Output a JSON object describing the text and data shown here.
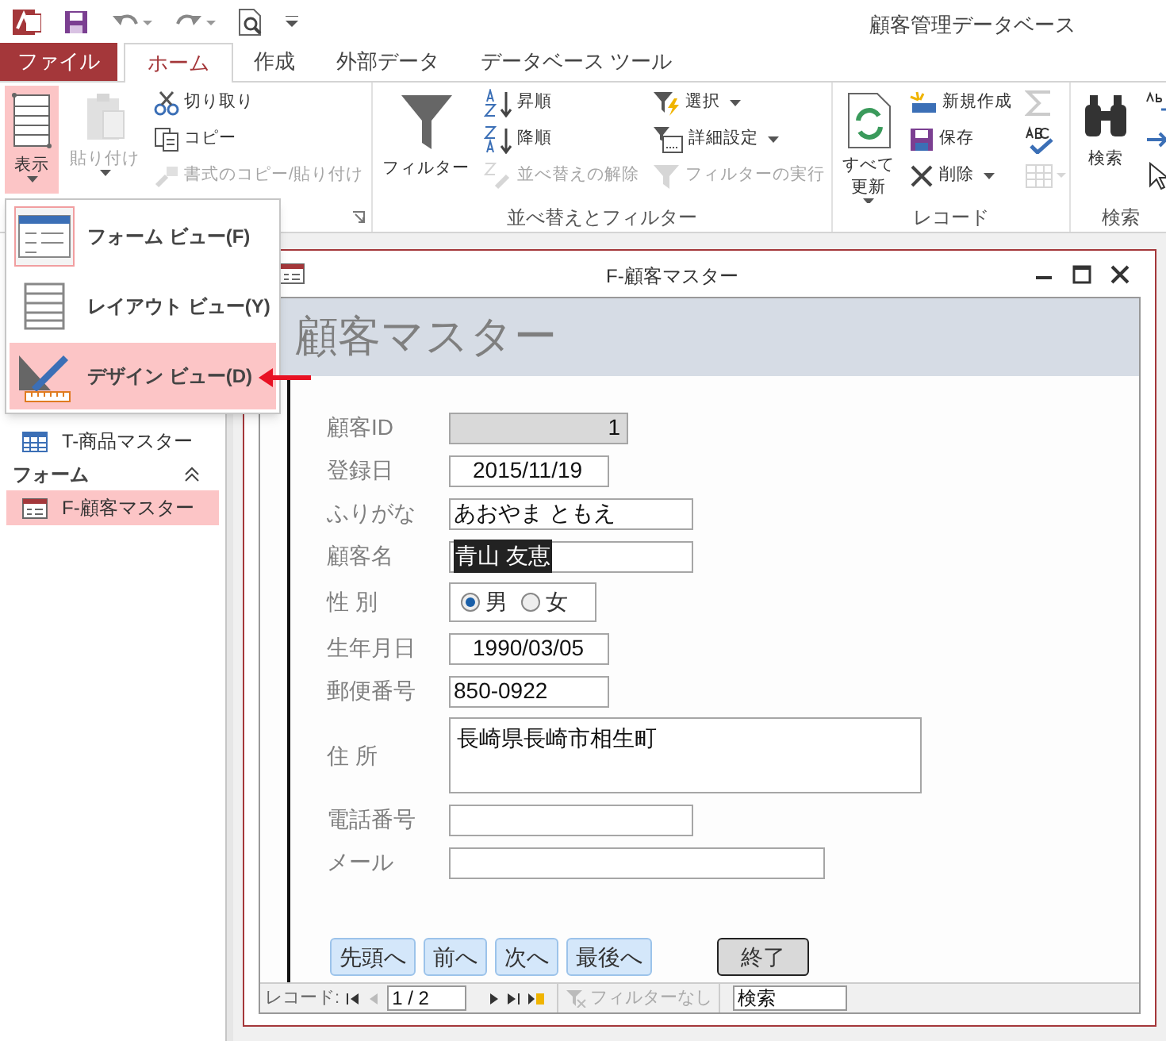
{
  "app": {
    "title": "顧客管理データベース"
  },
  "tabs": [
    {
      "label": "ファイル",
      "kind": "file",
      "selected": false
    },
    {
      "label": "ホーム",
      "kind": "tab",
      "selected": true
    },
    {
      "label": "作成",
      "kind": "tab",
      "selected": false
    },
    {
      "label": "外部データ",
      "kind": "tab",
      "selected": false
    },
    {
      "label": "データベース ツール",
      "kind": "tab",
      "selected": false
    }
  ],
  "ribbon": {
    "groups": [
      {
        "columns": [
          [
            {
              "label": "表示",
              "kind": "large",
              "dropdown": true,
              "pressed": true,
              "disabled": false
            }
          ],
          [
            {
              "label": "貼り付け",
              "kind": "large",
              "dropdown": true,
              "pressed": false,
              "disabled": true
            }
          ],
          [
            {
              "label": "切り取り",
              "kind": "small",
              "dropdown": false,
              "pressed": false,
              "disabled": false
            },
            {
              "label": "コピー",
              "kind": "small",
              "dropdown": false,
              "pressed": false,
              "disabled": false
            },
            {
              "label": "書式のコピー/貼り付け",
              "kind": "small",
              "dropdown": false,
              "pressed": false,
              "disabled": true
            }
          ]
        ]
      },
      {
        "label": "並べ替えとフィルター",
        "columns": [
          [
            {
              "label": "フィルター",
              "kind": "large",
              "dropdown": false,
              "pressed": false,
              "disabled": false
            }
          ],
          [
            {
              "label": "昇順",
              "kind": "small",
              "dropdown": false,
              "pressed": false,
              "disabled": false
            },
            {
              "label": "降順",
              "kind": "small",
              "dropdown": false,
              "pressed": false,
              "disabled": false
            },
            {
              "label": "並べ替えの解除",
              "kind": "small",
              "dropdown": false,
              "pressed": false,
              "disabled": true
            }
          ],
          [
            {
              "label": "選択",
              "kind": "small",
              "dropdown": true,
              "pressed": false,
              "disabled": false
            },
            {
              "label": "詳細設定",
              "kind": "small",
              "dropdown": true,
              "pressed": false,
              "disabled": false
            },
            {
              "label": "フィルターの実行",
              "kind": "small",
              "dropdown": false,
              "pressed": false,
              "disabled": true
            }
          ]
        ]
      },
      {
        "label": "レコード",
        "columns": [
          [
            {
              "label": "すべて更新",
              "kind": "large",
              "dropdown": true,
              "pressed": false,
              "disabled": false
            }
          ],
          [
            {
              "label": "新規作成",
              "kind": "small",
              "dropdown": false,
              "pressed": false,
              "disabled": false
            },
            {
              "label": "保存",
              "kind": "small",
              "dropdown": false,
              "pressed": false,
              "disabled": false
            },
            {
              "label": "削除",
              "kind": "small",
              "dropdown": true,
              "pressed": false,
              "disabled": false
            }
          ],
          [
            {
              "kind": "icon",
              "dropdown": false,
              "pressed": false,
              "disabled": true
            },
            {
              "kind": "icon",
              "dropdown": false,
              "pressed": false,
              "disabled": false
            },
            {
              "kind": "icon",
              "dropdown": true,
              "pressed": false,
              "disabled": true
            }
          ]
        ]
      },
      {
        "label": "検索",
        "columns": [
          [
            {
              "label": "検索",
              "kind": "large",
              "dropdown": false,
              "pressed": false,
              "disabled": false
            }
          ],
          [
            {
              "kind": "icon",
              "pressed": false,
              "disabled": false
            },
            {
              "kind": "icon",
              "pressed": false,
              "disabled": false
            },
            {
              "kind": "icon",
              "pressed": false,
              "disabled": false
            }
          ]
        ]
      }
    ]
  },
  "view_menu": {
    "items": [
      {
        "label": "フォーム ビュー(F)",
        "current": true,
        "selected": false
      },
      {
        "label": "レイアウト ビュー(Y)",
        "current": false,
        "selected": false
      },
      {
        "label": "デザイン ビュー(D)",
        "current": false,
        "selected": true
      }
    ]
  },
  "nav_pane": {
    "items": [
      {
        "label": "T-商品マスター",
        "kind": "table",
        "selected": false
      },
      {
        "label": "フォーム",
        "kind": "section",
        "expanded": true
      },
      {
        "label": "F-顧客マスター",
        "kind": "form",
        "selected": true
      }
    ]
  },
  "form_window": {
    "title": "F-顧客マスター",
    "header": "顧客マスター",
    "fields": [
      {
        "label": "顧客ID",
        "kind": "id",
        "value": "1",
        "value_selected": false
      },
      {
        "label": "登録日",
        "kind": "date",
        "value": "2015/11/19",
        "value_selected": false
      },
      {
        "label": "ふりがな",
        "kind": "text",
        "value": "あおやま ともえ",
        "value_selected": false
      },
      {
        "label": "顧客名",
        "kind": "text",
        "value": "青山 友恵",
        "value_selected": true
      },
      {
        "label": "性 別",
        "kind": "radio",
        "options": [
          {
            "label": "男",
            "selected": true
          },
          {
            "label": "女",
            "selected": false
          }
        ]
      },
      {
        "label": "生年月日",
        "kind": "date",
        "value": "1990/03/05",
        "value_selected": false
      },
      {
        "label": "郵便番号",
        "kind": "postal",
        "value": "850-0922",
        "value_selected": false
      },
      {
        "label": "住 所",
        "kind": "address",
        "value": "長崎県長崎市相生町",
        "value_selected": false
      },
      {
        "label": "電話番号",
        "kind": "text"
      },
      {
        "label": "メール",
        "kind": "email"
      }
    ],
    "buttons": [
      {
        "label": "先頭へ",
        "kind": "nav"
      },
      {
        "label": "前へ",
        "kind": "nav"
      },
      {
        "label": "次へ",
        "kind": "nav"
      },
      {
        "label": "最後へ",
        "kind": "nav"
      },
      {
        "label": "終了",
        "kind": "close"
      }
    ],
    "record_nav": {
      "label": "レコード:",
      "position": "1 / 2",
      "filter": "フィルターなし",
      "search_placeholder": "検索"
    }
  }
}
